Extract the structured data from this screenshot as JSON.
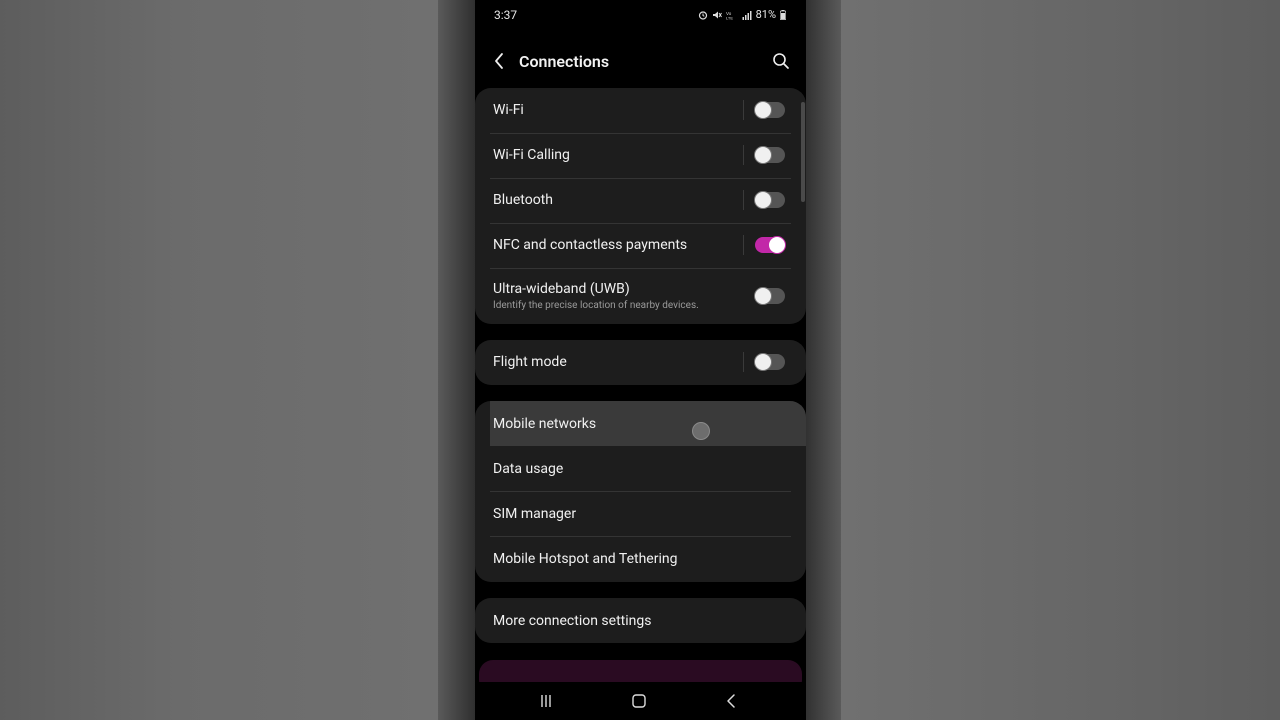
{
  "status_bar": {
    "time": "3:37",
    "icons": [
      "alarm-icon",
      "mute-icon",
      "volte-icon",
      "signal-icon",
      "battery-icon"
    ],
    "battery": "81%"
  },
  "header": {
    "title": "Connections"
  },
  "group1": [
    {
      "label": "Wi-Fi",
      "toggle": "off"
    },
    {
      "label": "Wi-Fi Calling",
      "toggle": "off"
    },
    {
      "label": "Bluetooth",
      "toggle": "off"
    },
    {
      "label": "NFC and contactless payments",
      "toggle": "on"
    },
    {
      "label": "Ultra-wideband (UWB)",
      "sub": "Identify the precise location of nearby devices.",
      "toggle": "off"
    }
  ],
  "group2": [
    {
      "label": "Flight mode",
      "toggle": "off"
    }
  ],
  "group3": [
    {
      "label": "Mobile networks"
    },
    {
      "label": "Data usage"
    },
    {
      "label": "SIM manager"
    },
    {
      "label": "Mobile Hotspot and Tethering"
    }
  ],
  "group4": [
    {
      "label": "More connection settings"
    }
  ],
  "colors": {
    "accent": "#c228a8",
    "card": "#1d1d1d",
    "background": "#000000"
  }
}
